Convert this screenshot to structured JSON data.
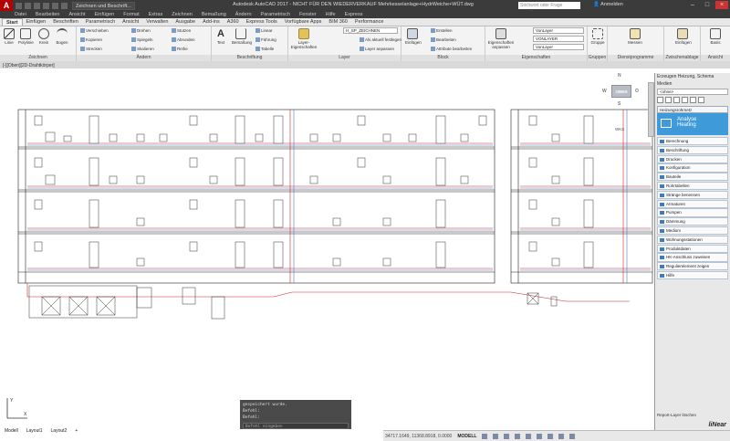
{
  "titlebar": {
    "logo": "A",
    "workspace": "Zeichnen und Beschrift...",
    "title": "Autodesk AutoCAD 2017 - NICHT FÜR DEN WIEDERVERKAUF    Mehrkesselanlage+HydrWeiche+WÜT.dwg",
    "search_placeholder": "Stichwort oder Frage eingeben",
    "user": "Anmelden"
  },
  "menubar": [
    "Datei",
    "Bearbeiten",
    "Ansicht",
    "Einfügen",
    "Format",
    "Extras",
    "Zeichnen",
    "Bemaßung",
    "Ändern",
    "Parametrisch",
    "Fenster",
    "Hilfe",
    "Express"
  ],
  "tabs": [
    "Start",
    "Einfügen",
    "Beschriften",
    "Parametrisch",
    "Ansicht",
    "Verwalten",
    "Ausgabe",
    "Add-ins",
    "A360",
    "Express Tools",
    "Vorfügbare Apps",
    "BIM 360",
    "Performance"
  ],
  "ribbon": {
    "zeichnen": {
      "title": "Zeichnen",
      "items": [
        "Linie",
        "Polylinie",
        "Kreis",
        "Bogen"
      ]
    },
    "aendern": {
      "title": "Ändern",
      "items": [
        "Verschieben",
        "Drehen",
        "Stutzen",
        "Kopieren",
        "Spiegeln",
        "Abrunden",
        "Strecken",
        "Skalieren",
        "Reihe"
      ]
    },
    "beschriftung": {
      "title": "Beschriftung",
      "items": [
        "Text",
        "Bemaßung",
        "Linear",
        "Führung",
        "Tabelle"
      ]
    },
    "layer": {
      "title": "Layer",
      "items": [
        "Layer-Eigenschaften",
        "Als aktuell festlegen",
        "Layer anpassen"
      ],
      "current": "H_SP_ZEICHNEN"
    },
    "block": {
      "title": "Block",
      "items": [
        "Einfügen",
        "Erstellen",
        "Bearbeiten",
        "Attribute bearbeiten"
      ]
    },
    "eigenschaften": {
      "title": "Eigenschaften",
      "items": [
        "Eigenschaften anpassen"
      ],
      "color": "VonLayer",
      "linetype": "VONLAYER",
      "lineweight": "VonLayer"
    },
    "gruppen": {
      "title": "Gruppen",
      "items": [
        "Gruppe"
      ]
    },
    "dienstprogramme": {
      "title": "Dienstprogramme",
      "items": [
        "Messen"
      ]
    },
    "zwischenablage": {
      "title": "Zwischenablage",
      "items": [
        "Einfügen"
      ]
    },
    "ansicht": {
      "title": "Ansicht",
      "items": [
        "Basis"
      ]
    }
  },
  "viewport": {
    "label": "[-][Oben][2D-Drahtkörper]",
    "viewcube": {
      "face": "OBEN",
      "n": "N",
      "s": "S",
      "w": "W",
      "o": "O"
    },
    "wcs": "WKS"
  },
  "command": {
    "lines": [
      "gespeichert wurde.",
      "Befehl:",
      "Befehl:"
    ],
    "placeholder": "Befehl eingeben"
  },
  "modeltabs": [
    "Modell",
    "Layout1",
    "Layout2",
    "+"
  ],
  "status": {
    "coords": "34717.1649, 11368.8918, 0.0000",
    "model": "MODELL"
  },
  "palette": {
    "header": "Erzeugen Heizung, Schema",
    "medium_label": "Medien",
    "medium_value": "<ohne>",
    "tab": "Heizungsrohrnetz",
    "banner_line1": "Analyse",
    "banner_line2": "Heating",
    "items": [
      "Berechnung",
      "Beschriftung",
      "Drucken",
      "Konfiguration",
      "Bauteile",
      "Rohrtabellen",
      "Stränge benennen",
      "Armaturen",
      "Pumpen",
      "Dämmung",
      "Medium",
      "Wohnungsstationen",
      "Produktdaten",
      "HK-Anschluss zuweisen",
      "Regulierelement zeigen",
      "Hilfe"
    ],
    "footer": "Report-Layer löschen",
    "logo": "liNear"
  }
}
